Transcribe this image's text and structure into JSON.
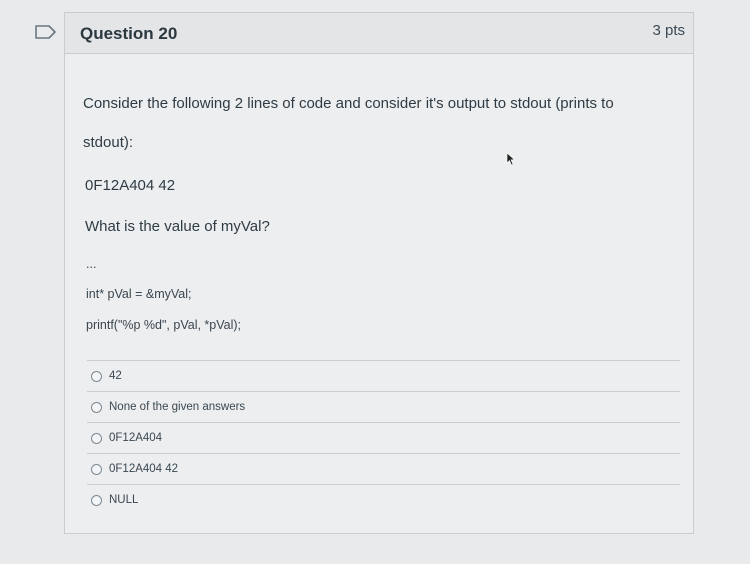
{
  "question": {
    "title": "Question 20",
    "points": "3 pts",
    "prompt_line1": "Consider the following 2 lines of code and consider it's output to stdout (prints to",
    "prompt_line2": "stdout):",
    "output_value": "0F12A404  42",
    "ask": "What is the value of myVal?",
    "ellipsis": "...",
    "code_line1": "int* pVal = &myVal;",
    "code_line2": "printf(\"%p  %d\", pVal, *pVal);"
  },
  "answers": [
    {
      "label": "42"
    },
    {
      "label": "None of the given answers"
    },
    {
      "label": "0F12A404"
    },
    {
      "label": "0F12A404 42"
    },
    {
      "label": "NULL"
    }
  ],
  "icons": {
    "flag": "flag-icon",
    "cursor": "cursor-icon",
    "radio": "radio-icon"
  }
}
